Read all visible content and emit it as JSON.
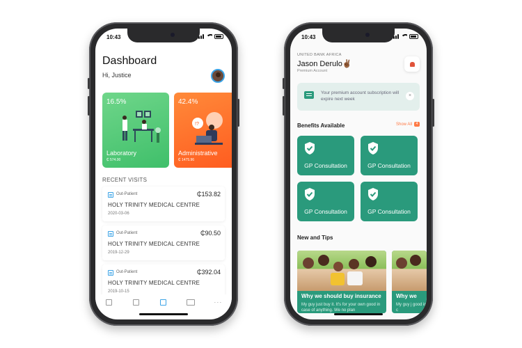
{
  "left": {
    "status_time": "10:43",
    "title": "Dashboard",
    "greeting": "Hi, Justice",
    "cards": [
      {
        "percent": "16.5%",
        "label": "Laboratory",
        "amount": "₵ 574.00"
      },
      {
        "percent": "42.4%",
        "label": "Administrative",
        "amount": "₵ 1475.96"
      }
    ],
    "recent_heading": "RECENT VISITS",
    "visits": [
      {
        "type": "Out-Patient",
        "amount": "₵153.82",
        "facility": "HOLY TRINITY MEDICAL CENTRE",
        "date": "2020-03-06"
      },
      {
        "type": "Out-Patient",
        "amount": "₵90.50",
        "facility": "HOLY TRINITY MEDICAL CENTRE",
        "date": "2019-12-29"
      },
      {
        "type": "Out-Patient",
        "amount": "₵392.04",
        "facility": "HOLY TRINITY MEDICAL CENTRE",
        "date": "2019-10-15"
      }
    ],
    "tabs": [
      "hospital-icon",
      "document-icon",
      "monitor-icon",
      "card-icon",
      "more-icon"
    ],
    "more_label": "···"
  },
  "right": {
    "status_time": "10:43",
    "bank": "UNITED BANK AFRICA",
    "user_name": "Jason Derulo✌🏾",
    "account": "Premium Account",
    "notice": "Your premium account subscription will expire next week",
    "notice_close": "×",
    "benefits_heading": "Benefits Available",
    "show_all": "Show All",
    "show_all_badge": "4",
    "benefits": [
      {
        "label": "GP Consultation"
      },
      {
        "label": "GP Consultation"
      },
      {
        "label": "GP Consultation"
      },
      {
        "label": "GP Consultation"
      }
    ],
    "news_heading": "New and Tips",
    "news": [
      {
        "title": "Why we should buy insurance",
        "desc": "My guy just buy it. It's for your own good in case of anything. We no plan"
      },
      {
        "title": "Why we",
        "desc": "My guy j good in c"
      }
    ]
  },
  "colors": {
    "green": "#2a9a7c",
    "lab_green": "#4cc975",
    "orange": "#ff6a2a",
    "accent_blue": "#3ba3e6"
  }
}
